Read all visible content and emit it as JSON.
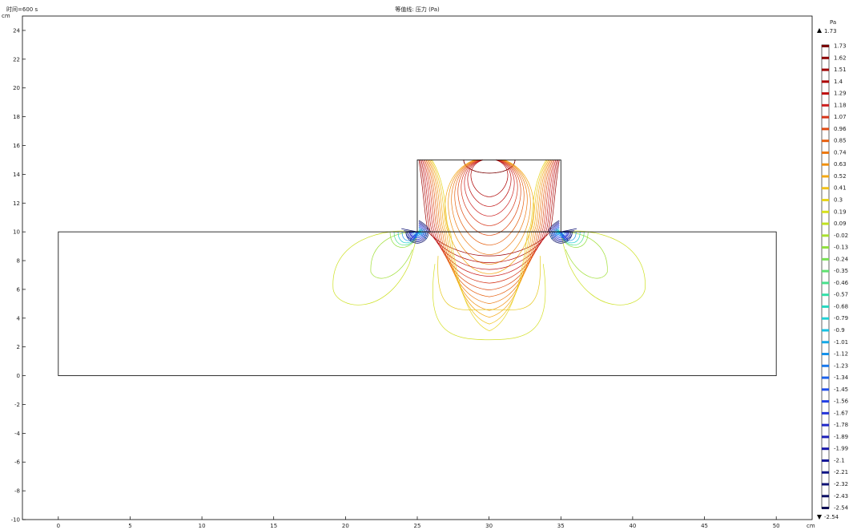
{
  "header": {
    "time_label": "时间=600 s",
    "plot_title": "等值线: 压力 (Pa)"
  },
  "chart_data": {
    "type": "contour",
    "title": "等值线: 压力 (Pa)",
    "subtitle": "时间=600 s",
    "x_unit": "cm",
    "y_unit": "cm",
    "xlim": [
      -2.5,
      52.5
    ],
    "ylim": [
      -10,
      25
    ],
    "x_ticks": [
      0,
      5,
      10,
      15,
      20,
      25,
      30,
      35,
      40,
      45,
      50
    ],
    "y_ticks": [
      -10,
      -8,
      -6,
      -4,
      -2,
      0,
      2,
      4,
      6,
      8,
      10,
      12,
      14,
      16,
      18,
      20,
      22,
      24
    ],
    "geometry": {
      "lower_domain": {
        "x": [
          0,
          50
        ],
        "y": [
          0,
          10
        ]
      },
      "upper_domain": {
        "x": [
          25,
          35
        ],
        "y": [
          10,
          15
        ]
      }
    },
    "colorbar": {
      "unit": "Pa",
      "max_label": "1.73",
      "min_label": "-2.54",
      "levels": [
        1.73,
        1.62,
        1.51,
        1.4,
        1.29,
        1.18,
        1.07,
        0.96,
        0.85,
        0.74,
        0.63,
        0.52,
        0.41,
        0.3,
        0.19,
        0.09,
        -0.02,
        -0.13,
        -0.24,
        -0.35,
        -0.46,
        -0.57,
        -0.68,
        -0.79,
        -0.9,
        -1.01,
        -1.12,
        -1.23,
        -1.34,
        -1.45,
        -1.56,
        -1.67,
        -1.78,
        -1.89,
        -1.99,
        -2.1,
        -2.21,
        -2.32,
        -2.43,
        -2.54
      ],
      "colors": [
        "#7a0000",
        "#8a0000",
        "#9c0000",
        "#ad0000",
        "#be1010",
        "#cc2020",
        "#d63418",
        "#de4a12",
        "#e66010",
        "#ec7810",
        "#f09010",
        "#f4a814",
        "#f0c018",
        "#e6d41c",
        "#d6e01c",
        "#c0e020",
        "#a8e030",
        "#90e040",
        "#78e054",
        "#60e070",
        "#48e08c",
        "#34e0a8",
        "#28d8c0",
        "#20d0d4",
        "#18c0e0",
        "#14a8e6",
        "#1490ea",
        "#1878ec",
        "#1c62ec",
        "#204eea",
        "#2440e4",
        "#2434d8",
        "#2028c8",
        "#1c20b8",
        "#1818a8",
        "#141896",
        "#101484",
        "#0e1274",
        "#0c1064",
        "#0a0c50"
      ]
    }
  }
}
